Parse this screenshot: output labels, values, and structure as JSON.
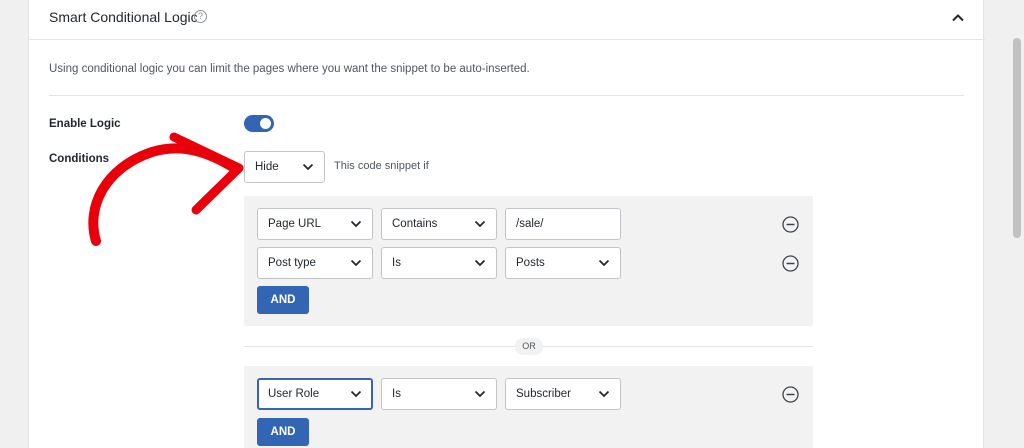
{
  "panel": {
    "title": "Smart Conditional Logic",
    "description": "Using conditional logic you can limit the pages where you want the snippet to be auto-inserted."
  },
  "enable_logic": {
    "label": "Enable Logic",
    "enabled": true
  },
  "conditions": {
    "label": "Conditions",
    "action_value": "Hide",
    "action_hint": "This code snippet if",
    "or_label": "OR",
    "and_label": "AND",
    "groups": [
      {
        "rules": [
          {
            "field": "Page URL",
            "operator": "Contains",
            "value": "/sale/"
          },
          {
            "field": "Post type",
            "operator": "Is",
            "value": "Posts"
          }
        ]
      },
      {
        "rules": [
          {
            "field": "User Role",
            "operator": "Is",
            "value": "Subscriber"
          }
        ]
      }
    ]
  },
  "colors": {
    "accent": "#3265b3",
    "arrow": "#e8000b"
  }
}
